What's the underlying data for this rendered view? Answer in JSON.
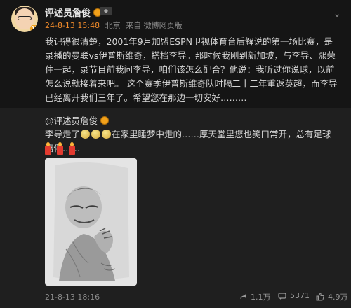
{
  "post": {
    "author": "评述员詹俊",
    "time": "24-8-13 15:48",
    "location": "北京",
    "source": "来自 微博网页版",
    "text": "我记得很清楚，2001年9月加盟ESPN卫视体育台后解说的第一场比赛，是录播的曼联vs伊普斯维奇，搭档李导。那时候我刚到新加坡，与李导、熙荣住一起，录节目前我问李导，咱们该怎么配合？他说：我听过你说球，以前怎么说就接着来吧。   这个赛季伊普斯维奇队时隔二十二年重返英超，而李导已经离开我们三年了。希望您在那边一切安好………"
  },
  "repost": {
    "author": "@评述员詹俊",
    "text_a": "李导走了",
    "text_b": "在家里睡梦中走的……厚天堂里您也笑口常开，总有足球陪伴……",
    "time": "21-8-13 18:16",
    "share_count": "1.1万",
    "comment_count": "5371",
    "like_count": "4.9万"
  },
  "icons": {
    "more": "chevron-down-icon",
    "share": "share-icon",
    "comment": "comment-icon",
    "like": "like-icon"
  }
}
